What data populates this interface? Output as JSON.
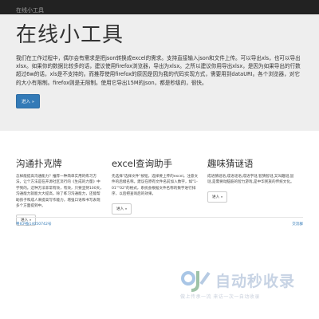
{
  "navbar": {
    "brand": "在线小工具"
  },
  "jumbotron": {
    "title": "在线小工具",
    "lead": "我们在工作过程中，偶尔会有需求是把json转换成excel的需求。支持直接输入json和文件上传。可以导出xls，也可以导出xlsx。如果你的数据比较多的话，建议使用firefox浏览器，导出为xlsx。之所以建议你用导出xlsx，是因为如果导出的行数超过6w的话，xls是不支持的。而推荐使用firefox的原因是因为我的代码实现方式，需要用到dataURI。各个浏览器，对它的大小有限制。firefox则是无限制。使用它导出15M的json，都是秒级的，很快。",
    "button": "进入 »"
  },
  "columns": [
    {
      "title": "沟通扑克牌",
      "body": "怎样能提高沟通能力？推荐一种简单实用的练习方法，让个方法是在开源社区流行的《生成的力量》中学到的。这种方法非常有效，有效，只要坚持100天，沟通能力就能大大提高，除了练习沟通能力，还能帮助孩子和成人来提高写作能力，增强口语和书写表现多个方面提到中。",
      "button": "进入 »"
    },
    {
      "title": "excel查询助手",
      "body": "先选择\"选择文件\"按钮，选择要上传的excel。注意文件的后缀名称。建议在原有文件名前加入数字，如\"1-01\"\"02\"的格式，系统会根据文件名称的数字进行排序，以后把查询后的效果。",
      "button": "进入 »"
    },
    {
      "title": "趣味猜谜语",
      "body": "成语猜谜语,成语谜语,成语字谜,智猜智谜,又叫趣谜,鼠谜,是需要动脑筋的智力游戏,是中华民族的传统文化。",
      "button": "进入 »"
    }
  ],
  "footer": {
    "left": "粤ICP备14050742号",
    "right": "交流群"
  },
  "watermark": {
    "title": "自动秒收录",
    "subtitle": "做上传承一流 来访一次一自动收录"
  }
}
